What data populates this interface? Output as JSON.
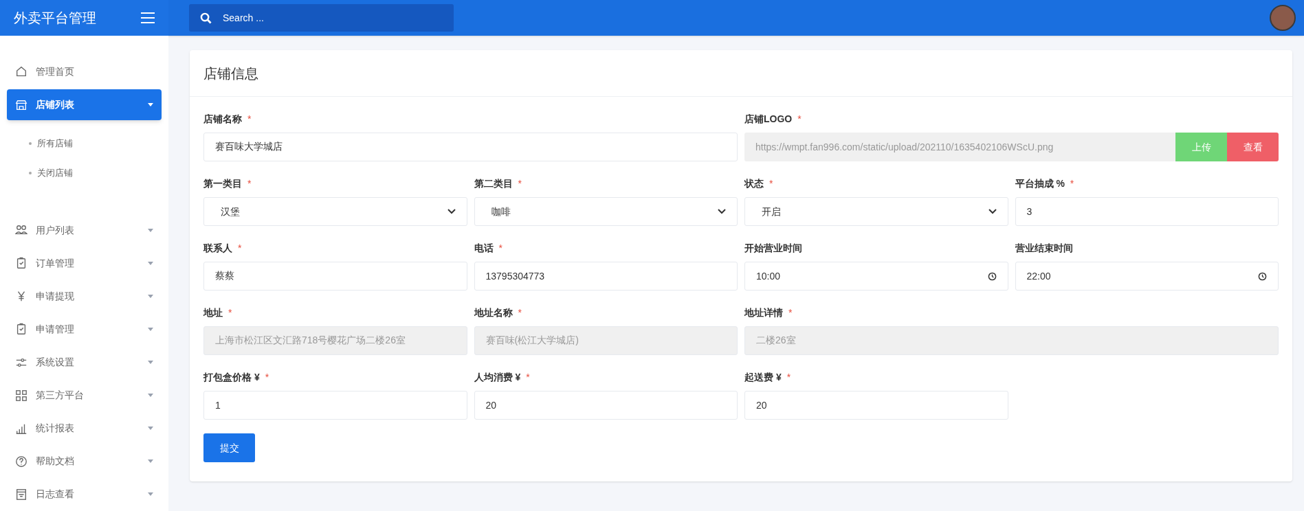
{
  "header": {
    "brand": "外卖平台管理",
    "search": {
      "placeholder": "Search ..."
    }
  },
  "sidebar": {
    "items": [
      {
        "label": "管理首页",
        "selected": false,
        "expanded": false,
        "has_caret": false
      },
      {
        "label": "店铺列表",
        "selected": true,
        "expanded": true,
        "has_caret": true,
        "children": [
          {
            "label": "所有店铺"
          },
          {
            "label": "关闭店铺"
          }
        ]
      },
      {
        "label": "用户列表",
        "selected": false,
        "expanded": false,
        "has_caret": true
      },
      {
        "label": "订单管理",
        "selected": false,
        "expanded": false,
        "has_caret": true
      },
      {
        "label": "申请提现",
        "selected": false,
        "expanded": false,
        "has_caret": true
      },
      {
        "label": "申请管理",
        "selected": false,
        "expanded": false,
        "has_caret": true
      },
      {
        "label": "系统设置",
        "selected": false,
        "expanded": false,
        "has_caret": true
      },
      {
        "label": "第三方平台",
        "selected": false,
        "expanded": false,
        "has_caret": true
      },
      {
        "label": "统计报表",
        "selected": false,
        "expanded": false,
        "has_caret": true
      },
      {
        "label": "帮助文档",
        "selected": false,
        "expanded": false,
        "has_caret": true
      },
      {
        "label": "日志查看",
        "selected": false,
        "expanded": false,
        "has_caret": true
      }
    ]
  },
  "card": {
    "title": "店铺信息",
    "field_rows": [
      {
        "fields": [
          {
            "label": "店铺名称",
            "required_mark": "*",
            "kind": "text",
            "value": "赛百味大学城店",
            "wide": true
          },
          {
            "label": "店铺LOGO",
            "required_mark": "*",
            "kind": "upload",
            "value": "https://wmpt.fan996.com/static/upload/202110/1635402106WScU.png",
            "wide": true,
            "buttons": [
              "上传",
              "查看"
            ]
          }
        ]
      },
      {
        "fields": [
          {
            "label": "第一类目",
            "required_mark": "*",
            "kind": "select",
            "value": "汉堡",
            "wide": false
          },
          {
            "label": "第二类目",
            "required_mark": "*",
            "kind": "select",
            "value": "咖啡",
            "wide": false
          },
          {
            "label": "状态",
            "required_mark": "*",
            "kind": "select",
            "value": "开启",
            "wide": false
          },
          {
            "label": "平台抽成 %",
            "required_mark": "*",
            "kind": "text",
            "value": "3",
            "wide": false
          }
        ]
      },
      {
        "fields": [
          {
            "label": "联系人",
            "required_mark": "*",
            "kind": "text",
            "value": "蔡蔡",
            "wide": false
          },
          {
            "label": "电话",
            "required_mark": "*",
            "kind": "text",
            "value": "13795304773",
            "wide": false
          },
          {
            "label": "开始营业时间",
            "kind": "time",
            "value": "10:00",
            "wide": false
          },
          {
            "label": "营业结束时间",
            "kind": "time",
            "value": "22:00",
            "wide": false
          }
        ]
      },
      {
        "fields": [
          {
            "label": "地址",
            "required_mark": "*",
            "kind": "readonly",
            "value": "上海市松江区文汇路718号樱花广场二楼26室",
            "wide": false
          },
          {
            "label": "地址名称",
            "required_mark": "*",
            "kind": "readonly",
            "value": "赛百味(松江大学城店)",
            "wide": false
          },
          {
            "label": "地址详情",
            "required_mark": "*",
            "kind": "readonly",
            "value": "二楼26室",
            "wide": true
          }
        ]
      },
      {
        "fields": [
          {
            "label": "打包盒价格 ¥",
            "required_mark": "*",
            "kind": "text",
            "value": "1",
            "wide": false
          },
          {
            "label": "人均消费 ¥",
            "required_mark": "*",
            "kind": "text",
            "value": "20",
            "wide": false
          },
          {
            "label": "起送费 ¥",
            "required_mark": "*",
            "kind": "text",
            "value": "20",
            "wide": false
          }
        ]
      }
    ],
    "submit": "提交"
  }
}
